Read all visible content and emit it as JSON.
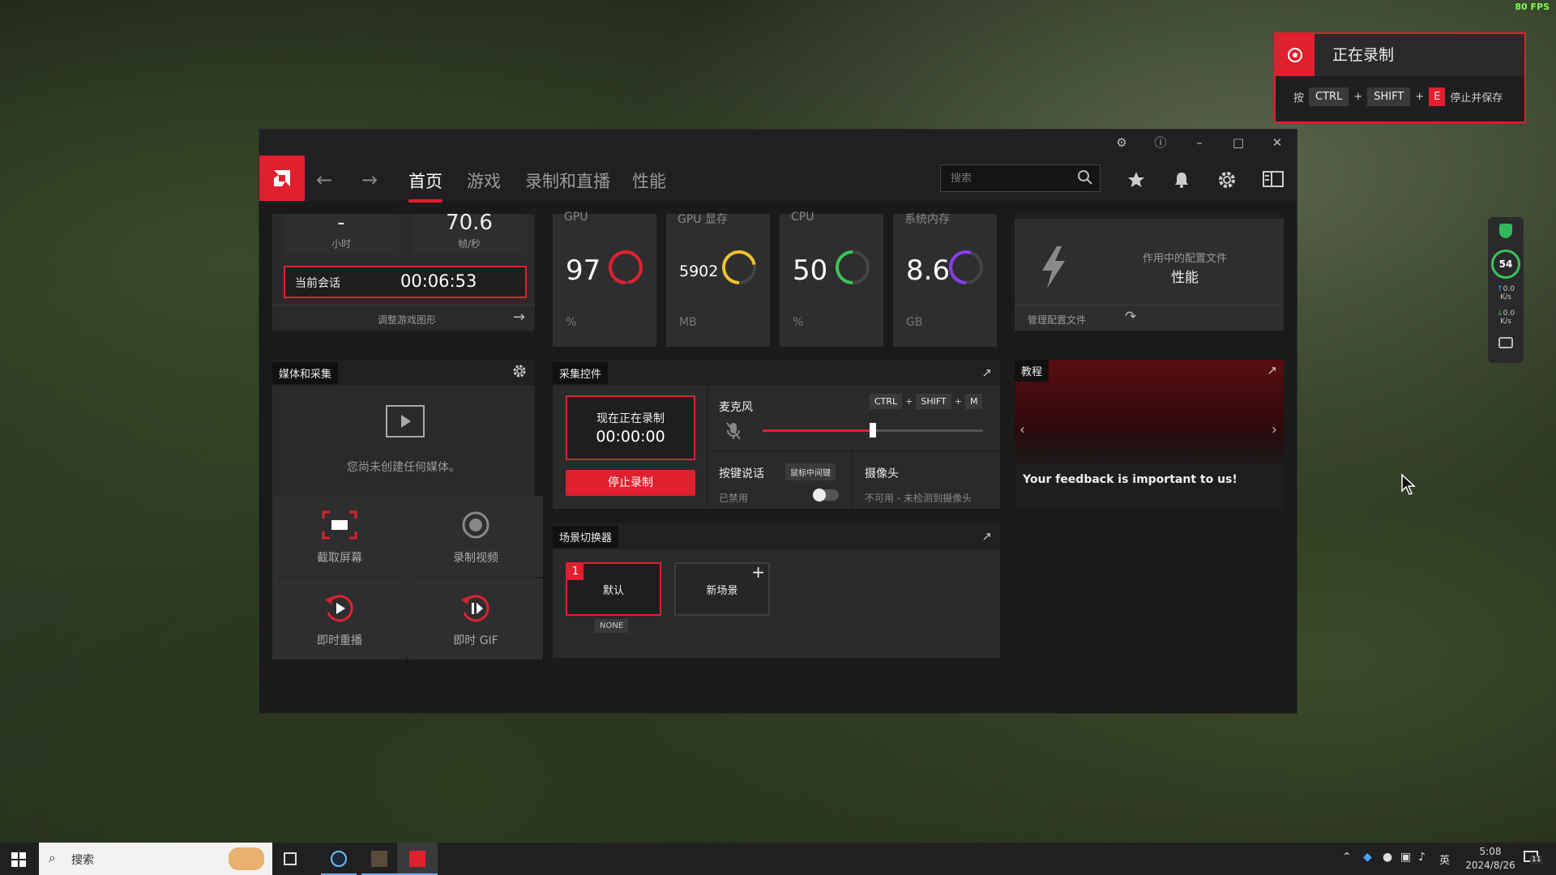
{
  "overlay": {
    "fps": "80 FPS"
  },
  "rec_notification": {
    "title": "正在录制",
    "press": "按",
    "key1": "CTRL",
    "plus1": "+",
    "key2": "SHIFT",
    "plus2": "+",
    "key3": "E",
    "action": "停止并保存"
  },
  "nav": {
    "tabs": [
      "首页",
      "游戏",
      "录制和直播",
      "性能"
    ],
    "search_placeholder": "搜索"
  },
  "session": {
    "hours_value": "-",
    "hours_unit": "小时",
    "fps_value": "70.6",
    "fps_unit": "帧/秒",
    "current_label": "当前会话",
    "current_time": "00:06:53",
    "adjust_link": "调整游戏图形"
  },
  "stats": [
    {
      "label": "GPU",
      "value": "97",
      "unit": "%",
      "fraction": 0.97,
      "color": "#e0202e"
    },
    {
      "label": "GPU 显存",
      "value": "5902",
      "unit": "MB",
      "fraction": 0.72,
      "color": "#f2c12e"
    },
    {
      "label": "CPU",
      "value": "50",
      "unit": "%",
      "fraction": 0.5,
      "color": "#3cc45a"
    },
    {
      "label": "系统内存",
      "value": "8.6",
      "unit": "GB",
      "fraction": 0.55,
      "color": "#8a3cf0"
    }
  ],
  "profile": {
    "caption": "作用中的配置文件",
    "name": "性能",
    "manage": "管理配置文件"
  },
  "media": {
    "title": "媒体和采集",
    "empty": "您尚未创建任何媒体。",
    "tiles": [
      "截取屏幕",
      "录制视频",
      "即时重播",
      "即时 GIF"
    ]
  },
  "capture": {
    "title": "采集控件",
    "now_recording": "现在正在录制",
    "rec_time": "00:00:00",
    "stop": "停止录制",
    "mic_label": "麦克风",
    "mic_keys": [
      "CTRL",
      "SHIFT",
      "M"
    ],
    "mic_level": 0.5,
    "ptt_label": "按键说话",
    "ptt_key": "鼠标中间键",
    "ptt_state": "已禁用",
    "camera_label": "摄像头",
    "camera_state": "不可用 - 未检测到摄像头"
  },
  "scenes": {
    "title": "场景切换器",
    "default_index": "1",
    "default_name": "默认",
    "default_hotkey": "NONE",
    "new_scene": "新场景"
  },
  "tutorial": {
    "title": "教程",
    "feedback": "Your feedback is important to us!"
  },
  "sidebar": {
    "gpu_percent": "54",
    "up_value": "0.0",
    "up_unit": "K/s",
    "down_value": "0.0",
    "down_unit": "K/s"
  },
  "taskbar": {
    "search": "搜索",
    "ime": "英",
    "time": "5:08",
    "date": "2024/8/26",
    "notif_count": "11"
  }
}
